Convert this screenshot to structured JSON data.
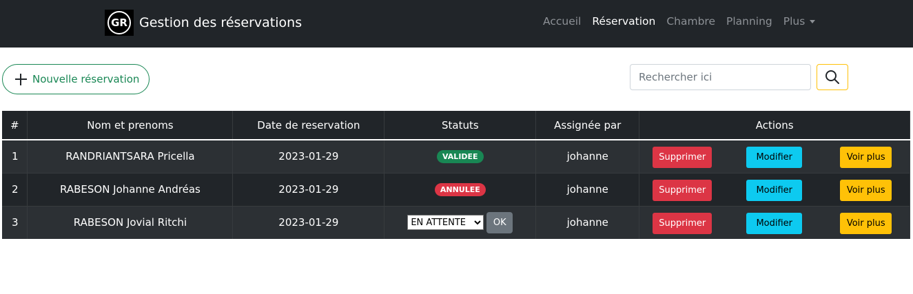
{
  "navbar": {
    "logo_text": "GR",
    "title": "Gestion des réservations",
    "links": [
      {
        "label": "Accueil",
        "active": false
      },
      {
        "label": "Réservation",
        "active": true
      },
      {
        "label": "Chambre",
        "active": false
      },
      {
        "label": "Planning",
        "active": false
      },
      {
        "label": "Plus",
        "active": false
      }
    ]
  },
  "toolbar": {
    "new_label": "Nouvelle réservation",
    "search_placeholder": "Rechercher ici"
  },
  "table": {
    "headers": [
      "#",
      "Nom et prenoms",
      "Date de reservation",
      "Statuts",
      "Assignée par",
      "Actions"
    ],
    "rows": [
      {
        "num": "1",
        "name": "RANDRIANTSARA Pricella",
        "date": "2023-01-29",
        "status": "VALIDEE",
        "assigned": "johanne"
      },
      {
        "num": "2",
        "name": "RABESON Johanne Andréas",
        "date": "2023-01-29",
        "status": "ANNULEE",
        "assigned": "johanne"
      },
      {
        "num": "3",
        "name": "RABESON Jovial Ritchi",
        "date": "2023-01-29",
        "status_select": "EN ATTENTE",
        "ok_label": "OK",
        "assigned": "johanne"
      }
    ],
    "actions": {
      "delete": "Supprimer",
      "edit": "Modifier",
      "more": "Voir plus"
    }
  },
  "colors": {
    "navbar": "#212529",
    "success": "#198754",
    "danger": "#dc3545",
    "info": "#0dcaf0",
    "warning": "#ffc107",
    "secondary": "#6c757d"
  }
}
